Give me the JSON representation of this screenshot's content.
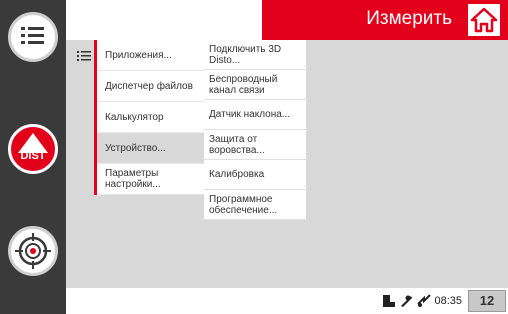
{
  "header": {
    "measure_label": "Измерить"
  },
  "rail": {
    "dist_label": "DIST"
  },
  "menu_primary": [
    {
      "label": "Приложения...",
      "selected": false
    },
    {
      "label": "Диспетчер файлов",
      "selected": false
    },
    {
      "label": "Калькулятор",
      "selected": false
    },
    {
      "label": "Устройство...",
      "selected": true
    },
    {
      "label": "Параметры настройки...",
      "selected": false
    }
  ],
  "menu_secondary": [
    {
      "label": "Подключить 3D Disto..."
    },
    {
      "label": "Беспроводный канал связи"
    },
    {
      "label": "Датчик наклона..."
    },
    {
      "label": "Защита от воровства..."
    },
    {
      "label": "Калибровка"
    },
    {
      "label": "Программное обеспечение..."
    }
  ],
  "status": {
    "time": "08:35",
    "page_indicator": "12"
  },
  "colors": {
    "accent": "#e3001b",
    "rail": "#3a3a3a",
    "panel": "#d8d8d8"
  },
  "icons": [
    "list-menu-icon",
    "dist-measure-icon",
    "target-icon",
    "home-icon",
    "battery-icon",
    "tilt-icon",
    "connection-icon"
  ]
}
